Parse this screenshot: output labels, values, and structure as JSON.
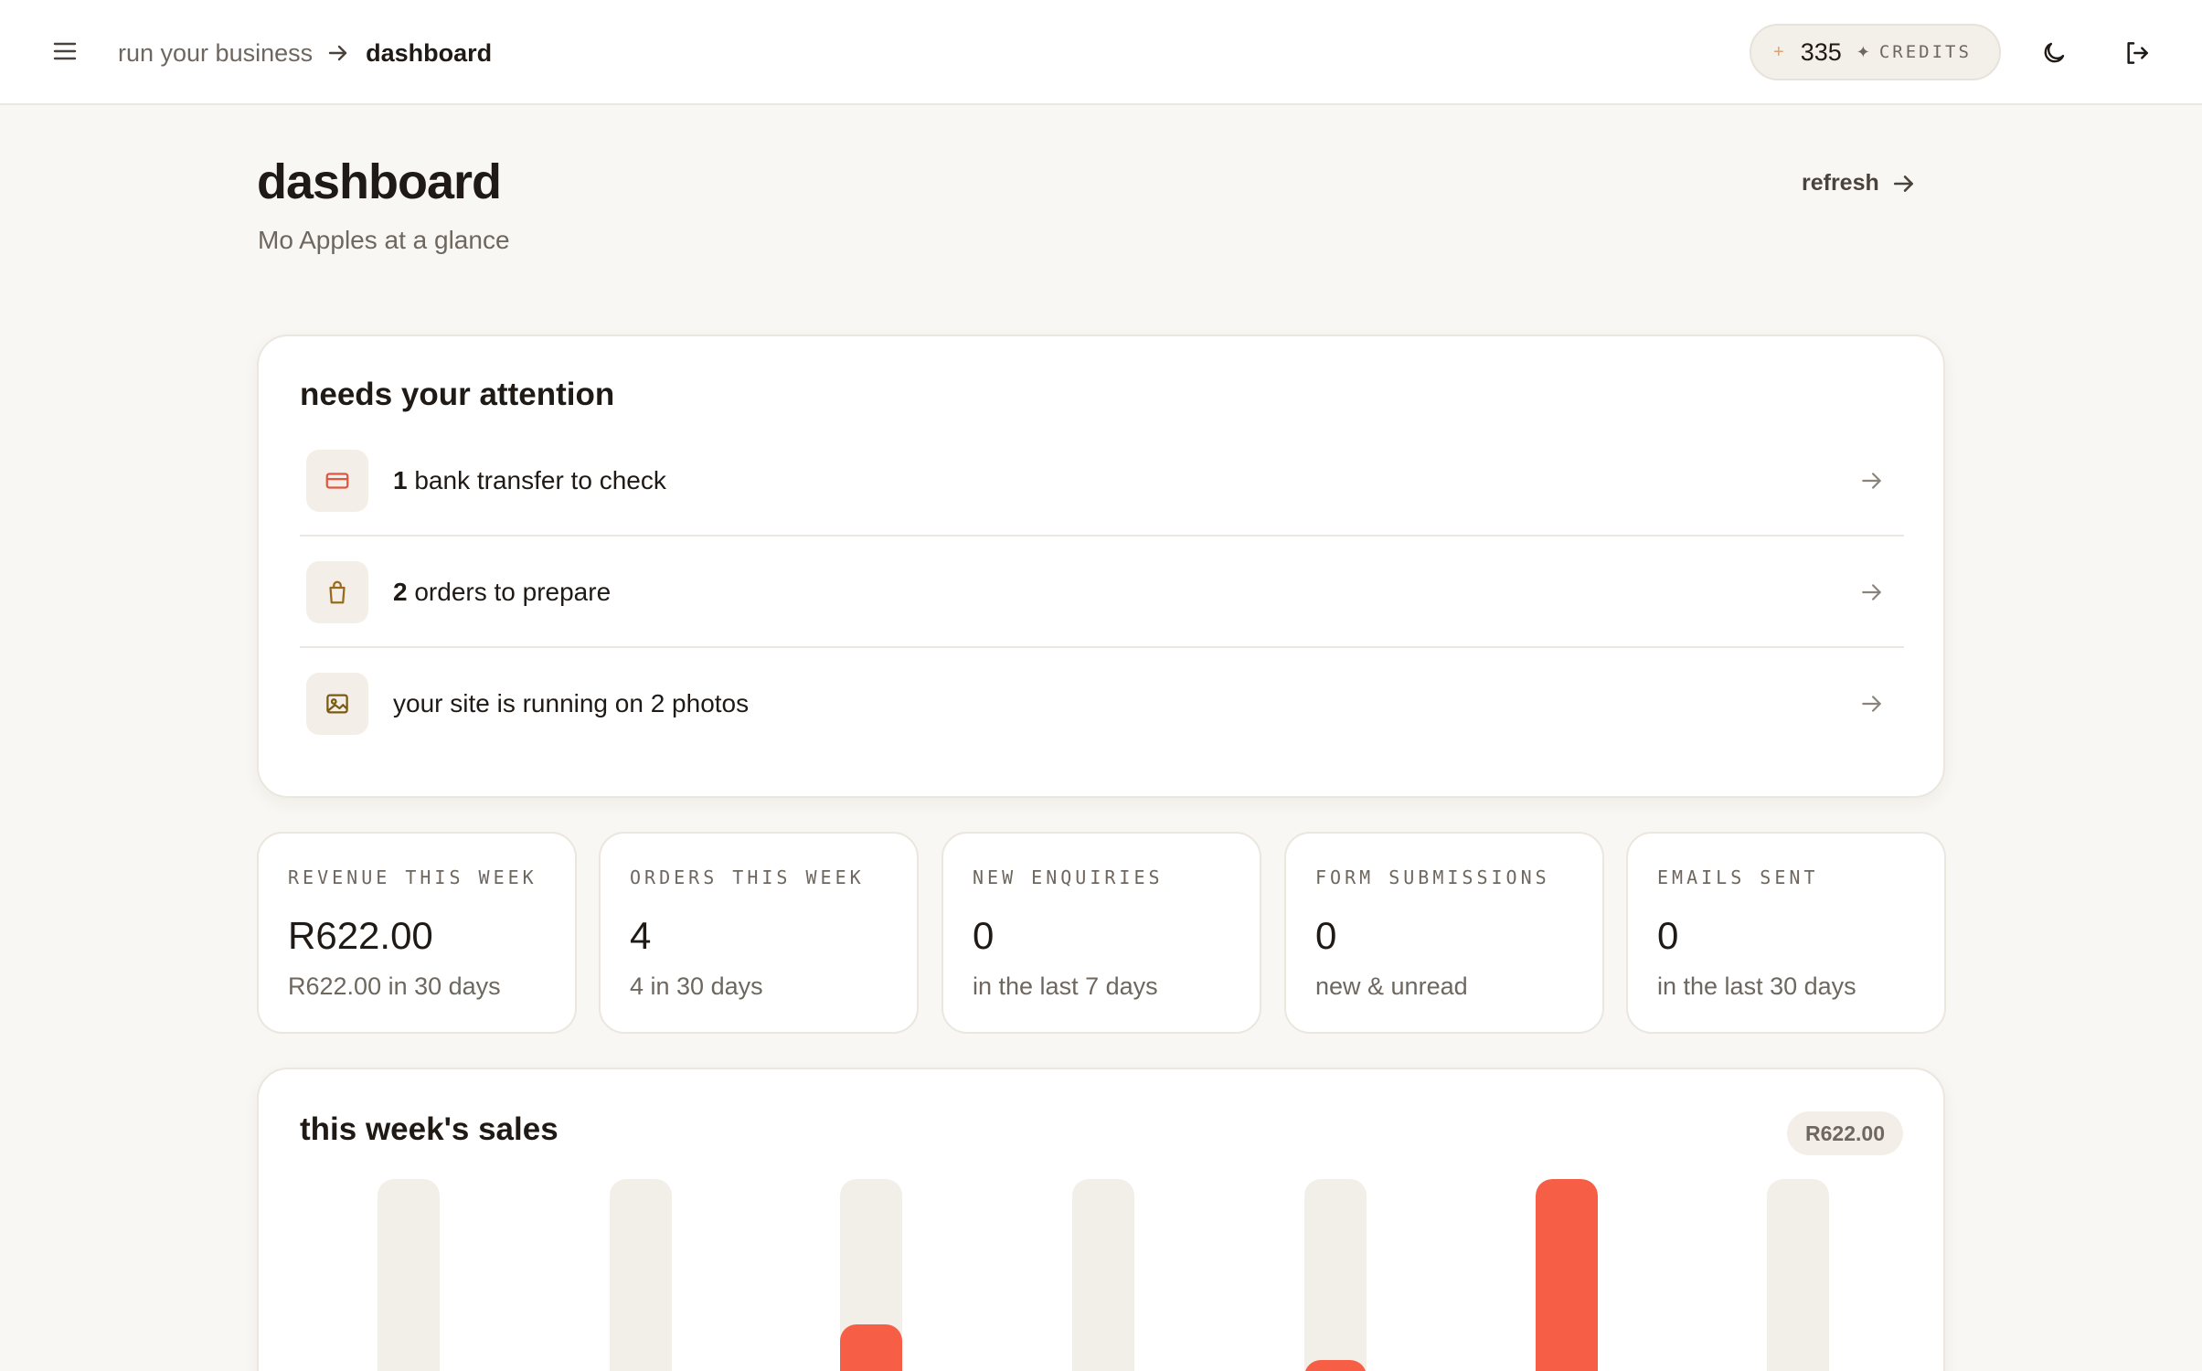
{
  "header": {
    "breadcrumb_root": "run your business",
    "breadcrumb_current": "dashboard",
    "credits_amount": "335",
    "credits_label": "CREDITS",
    "credits_spark": "+",
    "credits_dot": "✦"
  },
  "page": {
    "title": "dashboard",
    "subtitle": "Mo Apples at a glance",
    "refresh_label": "refresh"
  },
  "attention": {
    "title": "needs your attention",
    "items": [
      {
        "count": "1",
        "text": " bank transfer to check",
        "icon": "credit-card-icon"
      },
      {
        "count": "2",
        "text": " orders to prepare",
        "icon": "shopping-bag-icon"
      },
      {
        "count": "",
        "text": "your site is running on 2 photos",
        "icon": "image-icon"
      }
    ]
  },
  "stats": [
    {
      "label": "REVENUE THIS WEEK",
      "value": "R622.00",
      "sub": "R622.00 in 30 days"
    },
    {
      "label": "ORDERS THIS WEEK",
      "value": "4",
      "sub": "4 in 30 days"
    },
    {
      "label": "NEW ENQUIRIES",
      "value": "0",
      "sub": "in the last 7 days"
    },
    {
      "label": "FORM SUBMISSIONS",
      "value": "0",
      "sub": "new & unread"
    },
    {
      "label": "EMAILS SENT",
      "value": "0",
      "sub": "in the last 30 days"
    }
  ],
  "sales": {
    "title": "this week's sales",
    "total": "R622.00"
  },
  "chart_data": {
    "type": "bar",
    "title": "this week's sales",
    "values": [
      0,
      0,
      0.39,
      0,
      0.24,
      1.0,
      0
    ],
    "value_note": "relative share of max day (bars cropped at bottom of screenshot)",
    "colors": {
      "fill": "#f65f45",
      "track": "#f2efe9"
    }
  },
  "colors": {
    "accent": "#f65f45",
    "background": "#f9f7f3",
    "card": "#ffffff",
    "muted_text": "#6e675f"
  }
}
